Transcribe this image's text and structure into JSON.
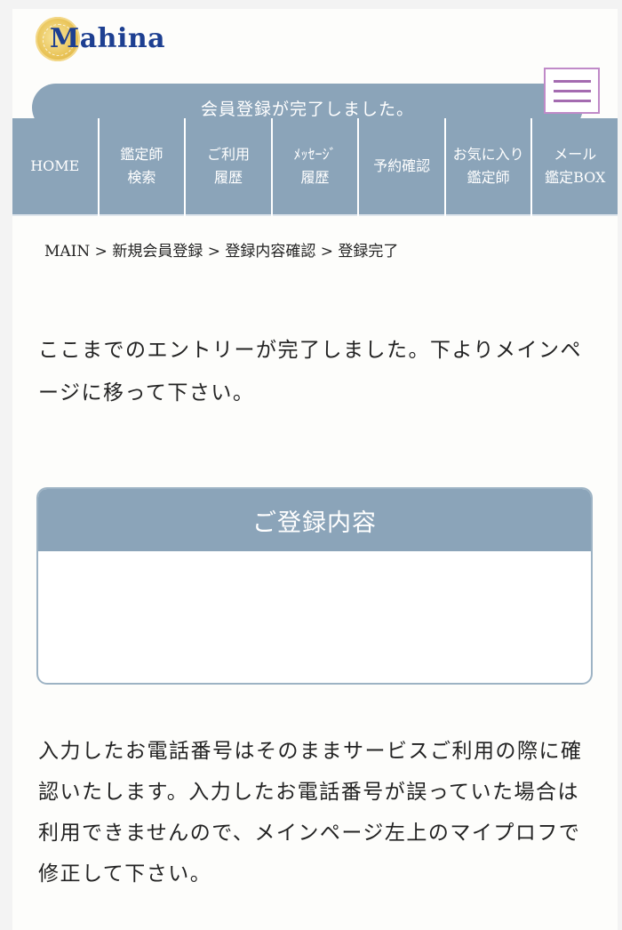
{
  "header": {
    "logo_text": "Mahina",
    "status_message": "会員登録が完了しました。"
  },
  "nav": {
    "items": [
      {
        "label": "HOME"
      },
      {
        "label": "鑑定師\n検索"
      },
      {
        "label": "ご利用\n履歴"
      },
      {
        "label": "ﾒｯｾｰｼﾞ\n履歴"
      },
      {
        "label": "予約確認"
      },
      {
        "label": "お気に入り\n鑑定師"
      },
      {
        "label": "メール\n鑑定BOX"
      }
    ]
  },
  "breadcrumb": "MAIN > 新規会員登録 > 登録内容確認 > 登録完了",
  "main": {
    "lead": "ここまでのエントリーが完了しました。下よりメインページに移って下さい。",
    "card_title": "ご登録内容",
    "note": "入力したお電話番号はそのままサービスご利用の際に確認いたします。入力したお電話番号が誤っていた場合は利用できませんので、メインページ左上のマイプロフで修正して下さい。"
  },
  "colors": {
    "accent": "#8ba4b9",
    "logo_blue": "#1d3f91",
    "menu_border": "#c08ac8"
  }
}
